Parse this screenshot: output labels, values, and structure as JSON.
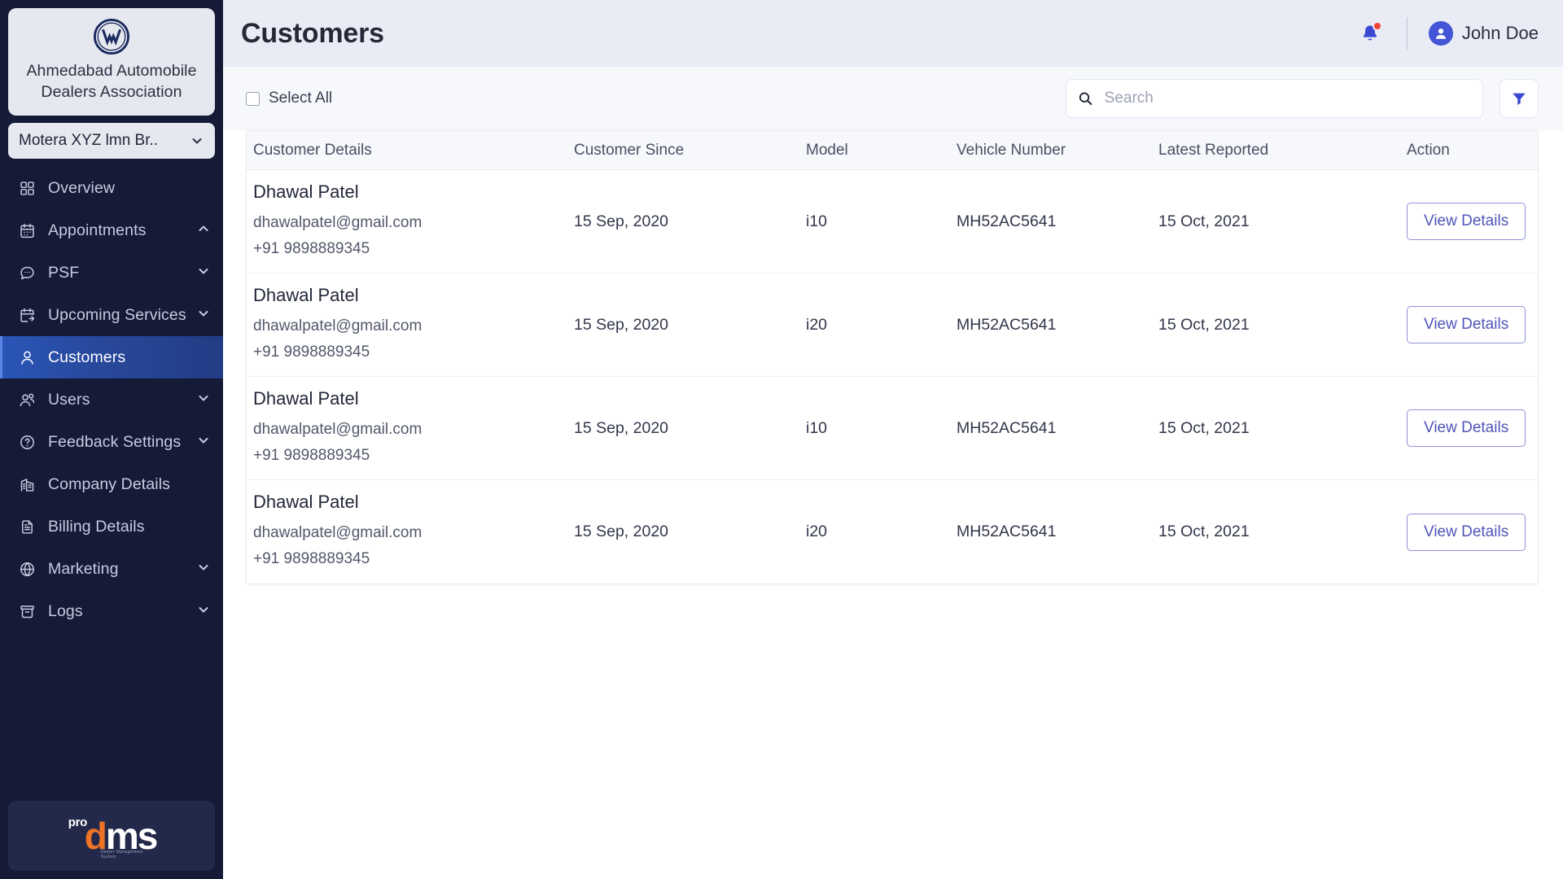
{
  "sidebar": {
    "brand": {
      "logo_icon": "volkswagen-logo",
      "name": "Ahmedabad Automobile Dealers Association"
    },
    "branch": {
      "label": "Motera XYZ lmn Br..",
      "icon": "chevron-down-icon"
    },
    "items": [
      {
        "label": "Overview",
        "icon": "grid-icon",
        "expandable": false,
        "chevron": "",
        "active": false
      },
      {
        "label": "Appointments",
        "icon": "calendar-icon",
        "expandable": true,
        "chevron": "chevron-up-icon",
        "active": false
      },
      {
        "label": "PSF",
        "icon": "chat-icon",
        "expandable": true,
        "chevron": "chevron-down-icon",
        "active": false
      },
      {
        "label": "Upcoming Services",
        "icon": "calendar-next-icon",
        "expandable": true,
        "chevron": "chevron-down-icon",
        "active": false
      },
      {
        "label": "Customers",
        "icon": "user-icon",
        "expandable": false,
        "chevron": "",
        "active": true
      },
      {
        "label": "Users",
        "icon": "users-icon",
        "expandable": true,
        "chevron": "chevron-down-icon",
        "active": false
      },
      {
        "label": "Feedback Settings",
        "icon": "question-icon",
        "expandable": true,
        "chevron": "chevron-down-icon",
        "active": false
      },
      {
        "label": "Company Details",
        "icon": "building-icon",
        "expandable": false,
        "chevron": "",
        "active": false
      },
      {
        "label": "Billing Details",
        "icon": "document-icon",
        "expandable": false,
        "chevron": "",
        "active": false
      },
      {
        "label": "Marketing",
        "icon": "globe-icon",
        "expandable": true,
        "chevron": "chevron-down-icon",
        "active": false
      },
      {
        "label": "Logs",
        "icon": "archive-icon",
        "expandable": true,
        "chevron": "chevron-down-icon",
        "active": false
      }
    ],
    "footer": {
      "logo_pro": "pro",
      "logo_d": "d",
      "logo_ms": "ms",
      "logo_tagline": "Dealer Management System"
    }
  },
  "header": {
    "title": "Customers",
    "notification_icon": "bell-icon",
    "has_notification": true,
    "avatar_icon": "user-avatar-icon",
    "user_name": "John Doe"
  },
  "toolbar": {
    "select_all_label": "Select All",
    "select_all_checked": false,
    "search_placeholder": "Search",
    "search_value": "",
    "search_icon": "search-icon",
    "filter_icon": "filter-icon"
  },
  "table": {
    "columns": [
      "Customer Details",
      "Customer Since",
      "Model",
      "Vehicle Number",
      "Latest Reported",
      "Action"
    ],
    "action_label": "View Details",
    "rows": [
      {
        "name": "Dhawal Patel",
        "email": "dhawalpatel@gmail.com",
        "phone": "+91 9898889345",
        "since": "15 Sep, 2020",
        "model": "i10",
        "vehicle": "MH52AC5641",
        "reported": "15 Oct, 2021",
        "action": "View Details"
      },
      {
        "name": "Dhawal Patel",
        "email": "dhawalpatel@gmail.com",
        "phone": "+91 9898889345",
        "since": "15 Sep, 2020",
        "model": "i20",
        "vehicle": "MH52AC5641",
        "reported": "15 Oct, 2021",
        "action": "View Details"
      },
      {
        "name": "Dhawal Patel",
        "email": "dhawalpatel@gmail.com",
        "phone": "+91 9898889345",
        "since": "15 Sep, 2020",
        "model": "i10",
        "vehicle": "MH52AC5641",
        "reported": "15 Oct, 2021",
        "action": "View Details"
      },
      {
        "name": "Dhawal Patel",
        "email": "dhawalpatel@gmail.com",
        "phone": "+91 9898889345",
        "since": "15 Sep, 2020",
        "model": "i20",
        "vehicle": "MH52AC5641",
        "reported": "15 Oct, 2021",
        "action": "View Details"
      }
    ]
  },
  "colors": {
    "sidebar_bg": "#151a37",
    "sidebar_active": "#2a56b8",
    "accent": "#4355d6",
    "header_bg": "#e9ebf5",
    "toolbar_bg": "#f7f8fc",
    "notification_dot": "#f04438",
    "logo_orange": "#ee7326"
  }
}
